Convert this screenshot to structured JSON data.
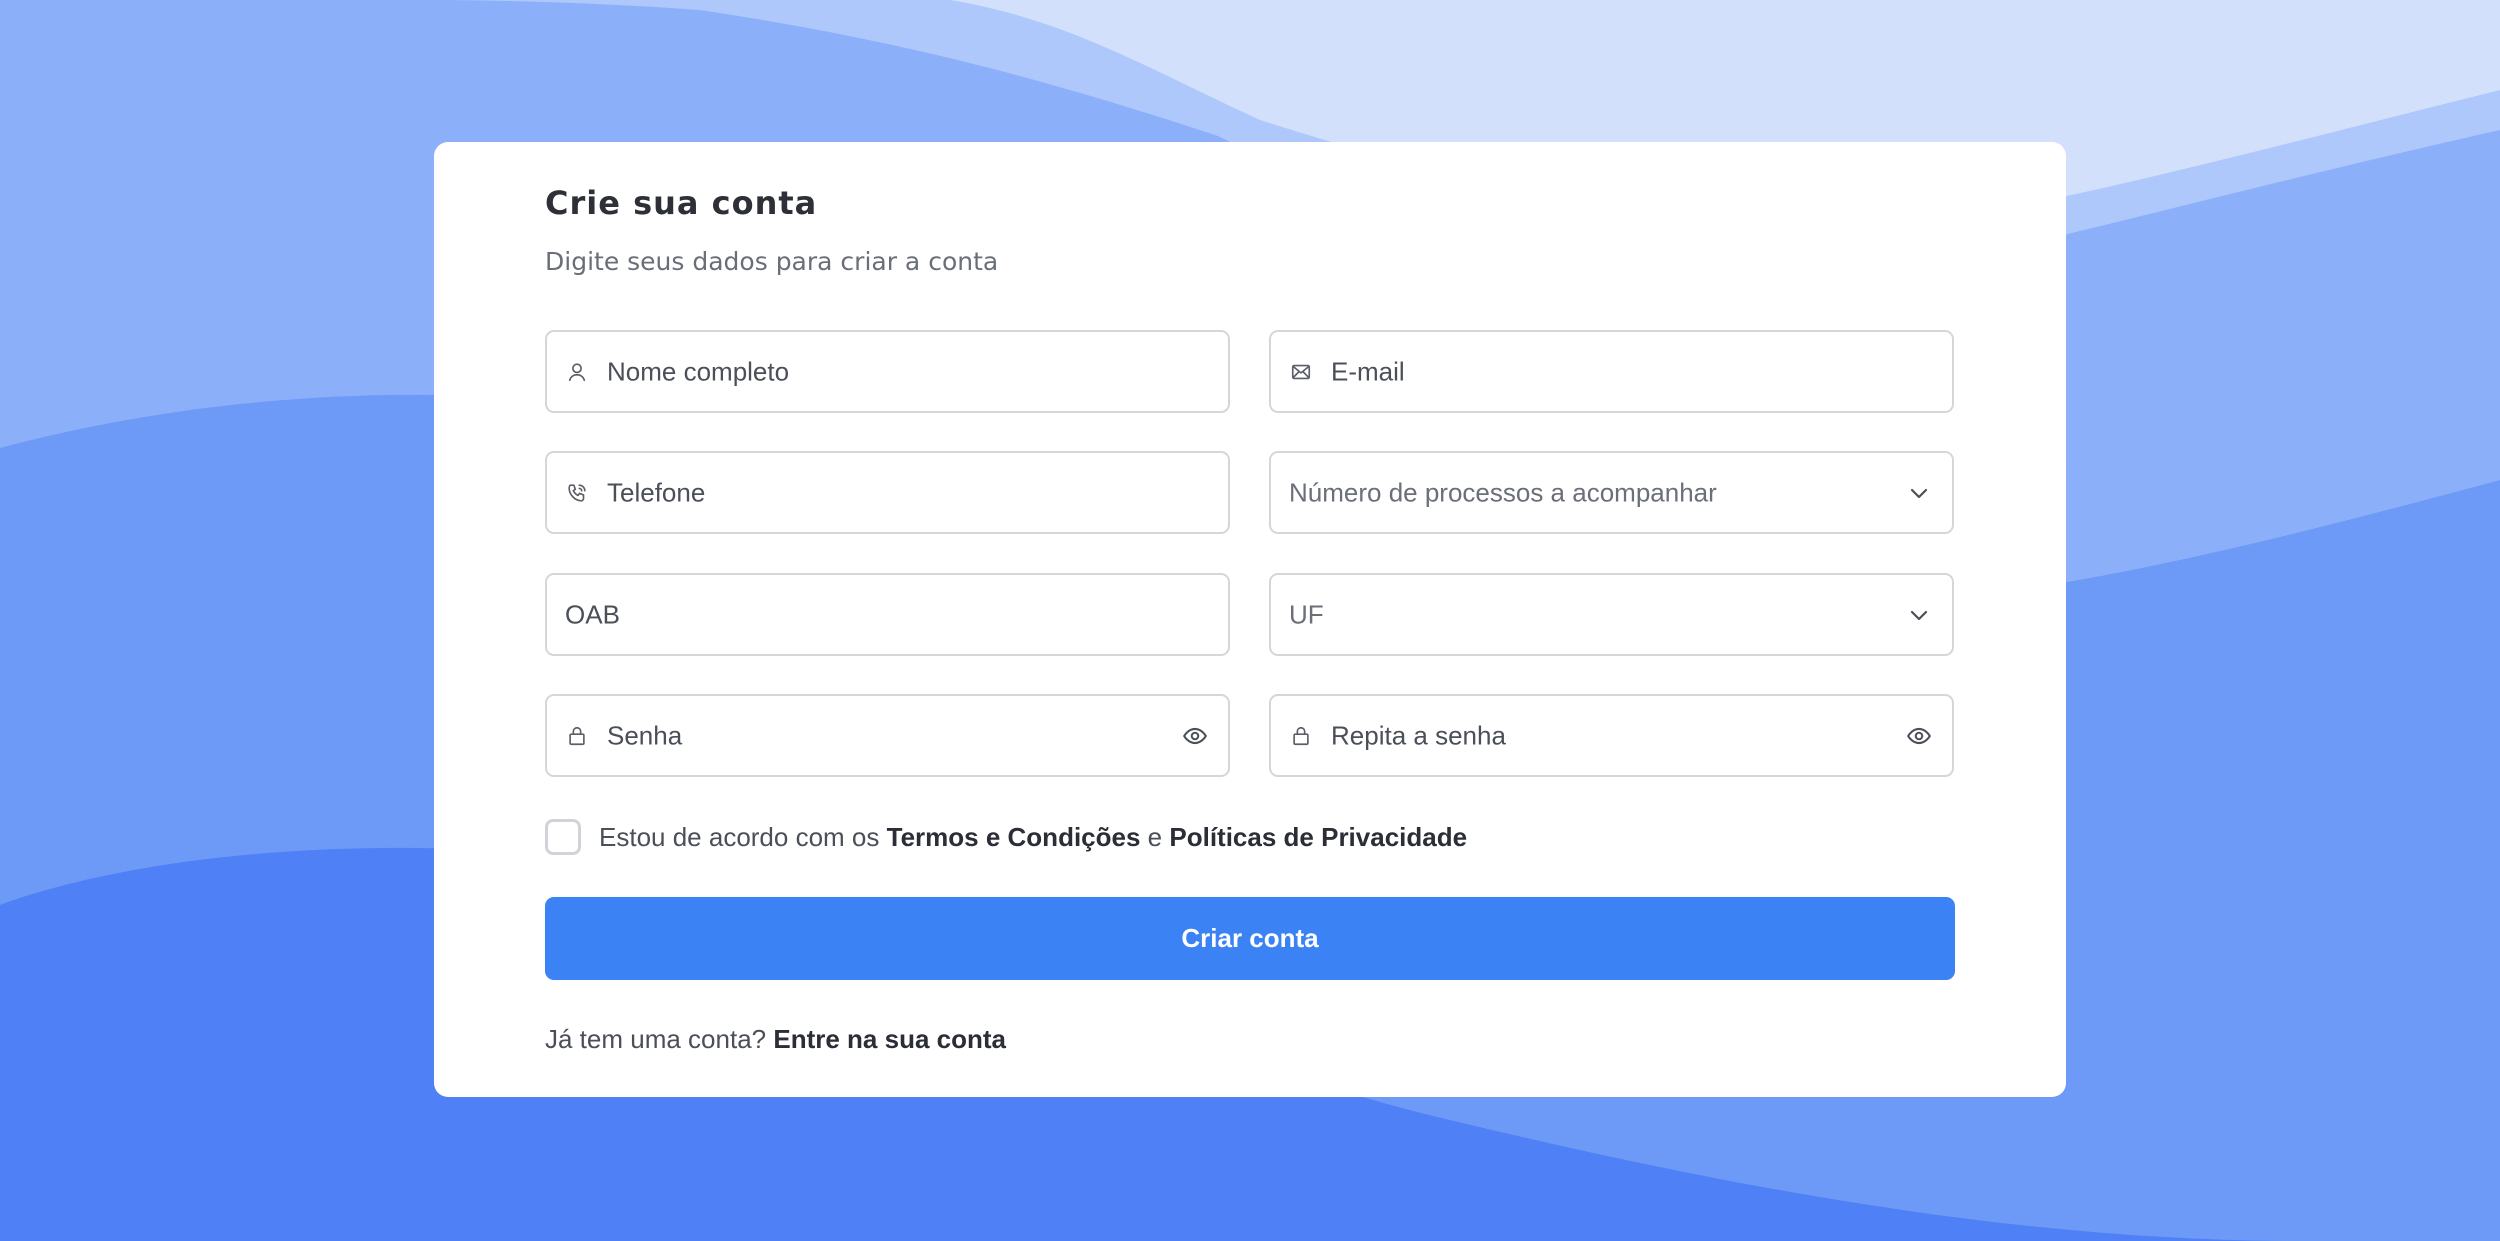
{
  "form": {
    "title": "Crie sua conta",
    "subtitle": "Digite seus dados para criar a conta",
    "fields": {
      "nome": {
        "placeholder": "Nome completo",
        "icon": "user-icon"
      },
      "email": {
        "placeholder": "E-mail",
        "icon": "envelope-icon"
      },
      "telefone": {
        "placeholder": "Telefone",
        "icon": "phone-icon"
      },
      "processos": {
        "placeholder": "Número de processos a acompanhar",
        "icon": "chevron-down-icon"
      },
      "oab": {
        "placeholder": "OAB"
      },
      "uf": {
        "placeholder": "UF",
        "icon": "chevron-down-icon"
      },
      "senha": {
        "placeholder": "Senha",
        "icon": "lock-icon",
        "trailing_icon": "eye-icon"
      },
      "repita_senha": {
        "placeholder": "Repita a senha",
        "icon": "lock-icon",
        "trailing_icon": "eye-icon"
      }
    },
    "terms": {
      "prefix": "Estou de acordo com os",
      "terms_link": "Termos e Condições",
      "connector": "e",
      "privacy_link": "Políticas de Privacidade",
      "checked": false
    },
    "submit_label": "Criar conta",
    "login": {
      "prompt": "Já tem uma conta?",
      "link": "Entre na sua conta"
    }
  },
  "colors": {
    "primary": "#3b82f5",
    "background": "#4f80f6",
    "text_dark": "#2e3038",
    "text_muted": "#6a6e78",
    "border": "#d4d6da"
  }
}
